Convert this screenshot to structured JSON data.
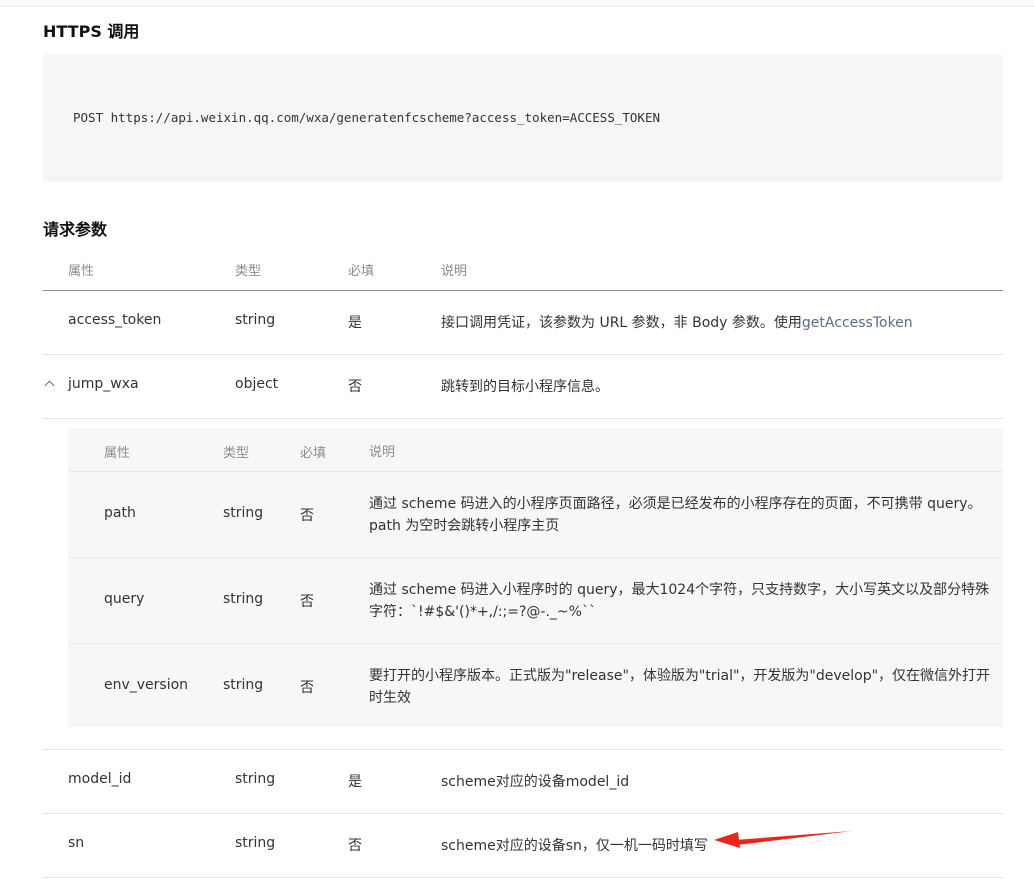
{
  "sections": {
    "https_title": "HTTPS 调用",
    "request_line": "POST https://api.weixin.qq.com/wxa/generatenfcscheme?access_token=ACCESS_TOKEN",
    "params_title": "请求参数"
  },
  "table": {
    "headers": [
      "属性",
      "类型",
      "必填",
      "说明"
    ],
    "rows": [
      {
        "name": "access_token",
        "type": "string",
        "required": "是",
        "desc": "接口调用凭证，该参数为 URL 参数，非 Body 参数。使用",
        "link": "getAccessToken"
      },
      {
        "name": "jump_wxa",
        "type": "object",
        "required": "否",
        "desc": "跳转到的目标小程序信息。"
      },
      {
        "name": "model_id",
        "type": "string",
        "required": "是",
        "desc": "scheme对应的设备model_id"
      },
      {
        "name": "sn",
        "type": "string",
        "required": "否",
        "desc": "scheme对应的设备sn，仅一机一码时填写"
      }
    ],
    "nested": {
      "headers": [
        "属性",
        "类型",
        "必填",
        "说明"
      ],
      "rows": [
        {
          "name": "path",
          "type": "string",
          "required": "否",
          "desc": "通过 scheme 码进入的小程序页面路径，必须是已经发布的小程序存在的页面，不可携带 query。path 为空时会跳转小程序主页"
        },
        {
          "name": "query",
          "type": "string",
          "required": "否",
          "desc": "通过 scheme 码进入小程序时的 query，最大1024个字符，只支持数字，大小写英文以及部分特殊字符：`!#$&'()*+,/:;=?@-._~%``"
        },
        {
          "name": "env_version",
          "type": "string",
          "required": "否",
          "desc": "要打开的小程序版本。正式版为\"release\"，体验版为\"trial\"，开发版为\"develop\"，仅在微信外打开时生效"
        }
      ]
    }
  },
  "icons": {
    "expand": "chevron-up-icon",
    "annotation": "red-arrow-icon"
  },
  "colors": {
    "link": "#576b95",
    "annotation_arrow": "#e8261c",
    "code_bg": "#f6f6f6"
  }
}
